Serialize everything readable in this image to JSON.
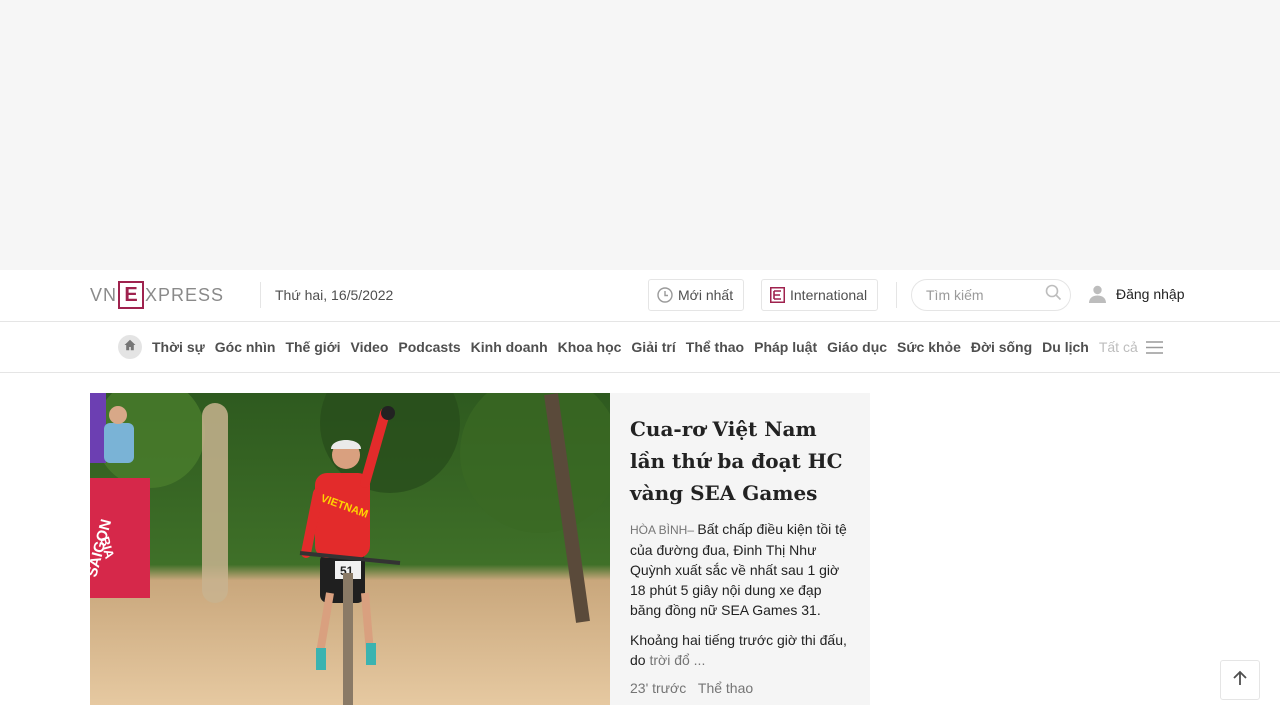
{
  "header": {
    "logo_left": "VN",
    "logo_box": "E",
    "logo_right": "XPRESS",
    "date": "Thứ hai, 16/5/2022",
    "latest_label": "Mới nhất",
    "international_label": "International",
    "search_placeholder": "Tìm kiếm",
    "login_label": "Đăng nhập",
    "brand_color": "#9f224e"
  },
  "nav": {
    "items": [
      "Thời sự",
      "Góc nhìn",
      "Thế giới",
      "Video",
      "Podcasts",
      "Kinh doanh",
      "Khoa học",
      "Giải trí",
      "Thể thao",
      "Pháp luật",
      "Giáo dục",
      "Sức khỏe",
      "Đời sống",
      "Du lịch"
    ],
    "all_label": "Tất cả"
  },
  "article": {
    "title": "Cua-rơ Việt Nam lần thứ ba đoạt HC vàng SEA Games",
    "location": "Hòa Bình",
    "lead": "Bất chấp điều kiện tồi tệ của đường đua, Đinh Thị Như Quỳnh xuất sắc về nhất sau 1 giờ 18 phút 5 giây nội dung xe đạp băng đồng nữ SEA Games 31.",
    "body_start": "Khoảng hai tiếng trước giờ thi đấu, do",
    "body_more": "trời đổ ...",
    "time": "23' trước",
    "category": "Thể thao",
    "image_text": {
      "jersey": "VIETNAM",
      "bib": "51",
      "banner_line1": "BIA",
      "banner_line2": "SAIGON"
    }
  }
}
